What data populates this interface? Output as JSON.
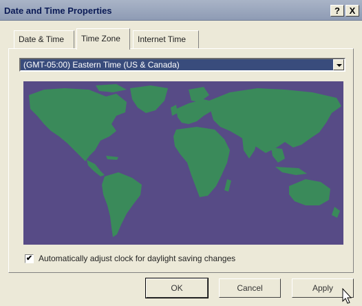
{
  "window": {
    "title": "Date and Time Properties",
    "help_label": "?",
    "close_label": "X"
  },
  "tabs": [
    {
      "label": "Date & Time"
    },
    {
      "label": "Time Zone",
      "active": true
    },
    {
      "label": "Internet Time"
    }
  ],
  "timezone": {
    "selected": "(GMT-05:00) Eastern Time (US & Canada)"
  },
  "map": {
    "ocean_color": "#574b86",
    "land_color": "#3a8a5a"
  },
  "daylight": {
    "checked": true,
    "check_mark": "✔",
    "label": "Automatically adjust clock for daylight saving changes"
  },
  "buttons": {
    "ok": "OK",
    "cancel": "Cancel",
    "apply": "Apply"
  },
  "icons": {
    "cursor": "mouse-pointer-icon"
  }
}
